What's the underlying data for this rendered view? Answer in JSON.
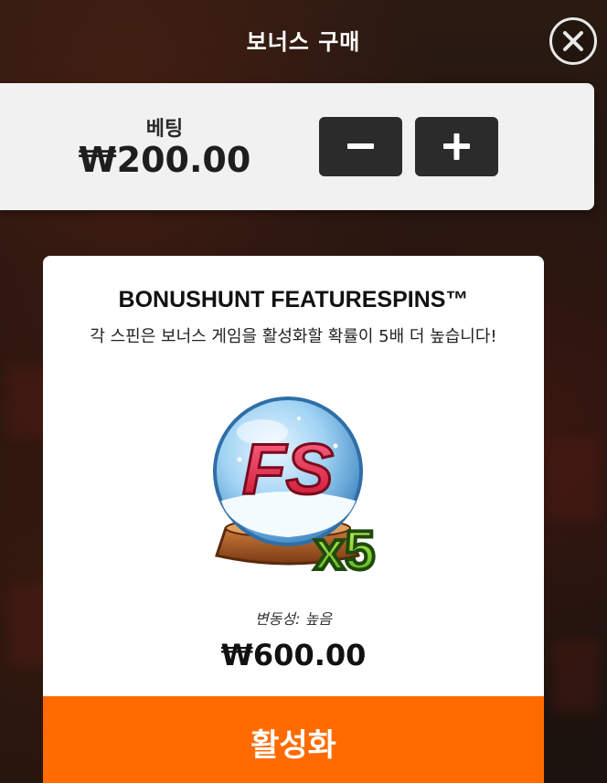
{
  "header": {
    "title": "보너스 구매",
    "close_icon": "close-icon"
  },
  "bet": {
    "label": "베팅",
    "value": "₩200.00",
    "minus_icon": "minus-icon",
    "plus_icon": "plus-icon"
  },
  "bonus_card": {
    "title": "BONUSHUNT FEATURESPINS™",
    "description": "각 스핀은 보너스 게임을 활성화할 확률이 5배 더 높습니다!",
    "art": {
      "globe_text": "FS",
      "multiplier_text": "x5"
    },
    "volatility": "변동성: 높음",
    "price": "₩600.00",
    "activate_label": "활성화"
  },
  "colors": {
    "accent_orange": "#ff6b00",
    "panel_bg": "#f1f1f1",
    "button_dark": "#2b2b2b",
    "card_bg": "#ffffff",
    "backdrop": "#20140f"
  }
}
